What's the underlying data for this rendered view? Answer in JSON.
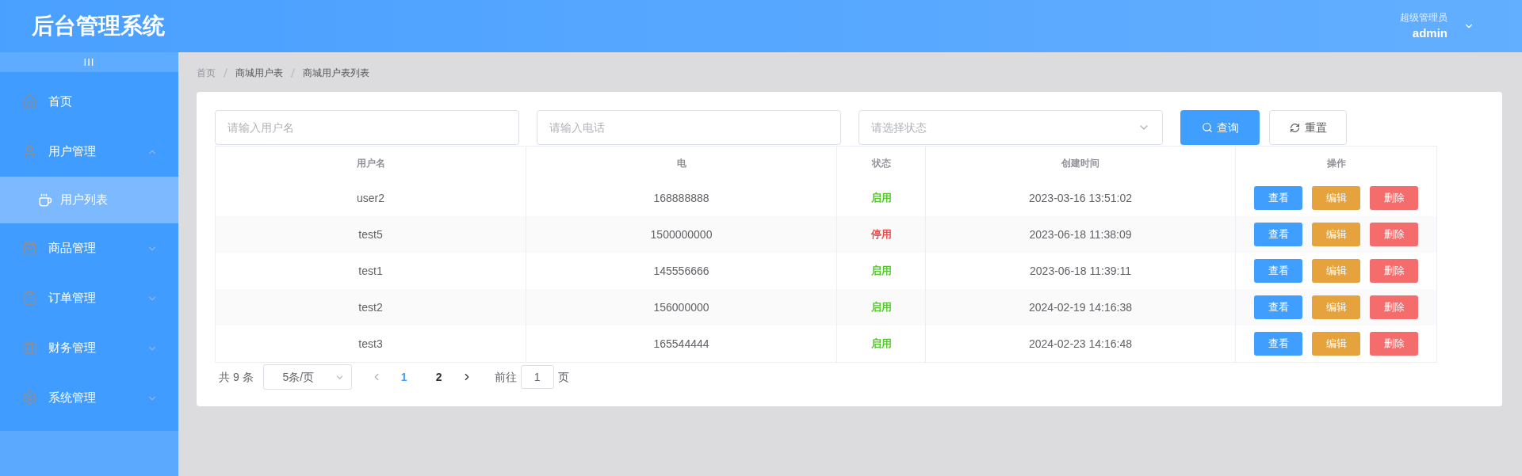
{
  "header": {
    "title": "后台管理系统",
    "user_role": "超级管理员",
    "user_name": "admin"
  },
  "sidebar": {
    "collapse_toggle": "III",
    "items": [
      {
        "label": "首页",
        "kind": "home",
        "selected": false
      },
      {
        "label": "用户管理",
        "kind": "user",
        "expanded": true,
        "selected": false,
        "children": [
          {
            "label": "用户列表",
            "kind": "cup",
            "selected": true
          }
        ]
      },
      {
        "label": "商品管理",
        "kind": "bag",
        "expanded": false,
        "selected": false
      },
      {
        "label": "订单管理",
        "kind": "clipboard",
        "expanded": false,
        "selected": false
      },
      {
        "label": "财务管理",
        "kind": "briefcase",
        "expanded": false,
        "selected": false
      },
      {
        "label": "系统管理",
        "kind": "gear",
        "expanded": false,
        "selected": false
      }
    ]
  },
  "breadcrumb": [
    "首页",
    "商城用户表",
    "商城用户表列表"
  ],
  "filters": {
    "username": {
      "placeholder": "请输入用户名"
    },
    "phone": {
      "placeholder": "请输入电话"
    },
    "status": {
      "placeholder": "请选择状态"
    },
    "search_button": "查询",
    "reset_button": "重置"
  },
  "table": {
    "columns": [
      "用户名",
      "电",
      "状态",
      "创建时间",
      "操作"
    ],
    "rows": [
      {
        "username": "user2",
        "phone": "168888888",
        "status": "启用",
        "enabled": true,
        "created": "2023-03-16 13:51:02",
        "actions": [
          "查看",
          "编辑",
          "删除"
        ]
      },
      {
        "username": "test5",
        "phone": "1500000000",
        "status": "停用",
        "enabled": false,
        "created": "2023-06-18 11:38:09",
        "actions": [
          "查看",
          "编辑",
          "删除"
        ]
      },
      {
        "username": "test1",
        "phone": "145556666",
        "status": "启用",
        "enabled": true,
        "created": "2023-06-18 11:39:11",
        "actions": [
          "查看",
          "编辑",
          "删除"
        ]
      },
      {
        "username": "test2",
        "phone": "156000000",
        "status": "启用",
        "enabled": true,
        "created": "2024-02-19 14:16:38",
        "actions": [
          "查看",
          "编辑",
          "删除"
        ]
      },
      {
        "username": "test3",
        "phone": "165544444",
        "status": "启用",
        "enabled": true,
        "created": "2024-02-23 14:16:48",
        "actions": [
          "查看",
          "编辑",
          "删除"
        ]
      }
    ]
  },
  "pagination": {
    "total": "共 9 条",
    "page_size": "5条/页",
    "pages": [
      {
        "label": "1",
        "selected": true
      },
      {
        "label": "2",
        "selected": false
      }
    ],
    "goto_label": "前往",
    "goto_value": "1",
    "goto_suffix": "页"
  }
}
